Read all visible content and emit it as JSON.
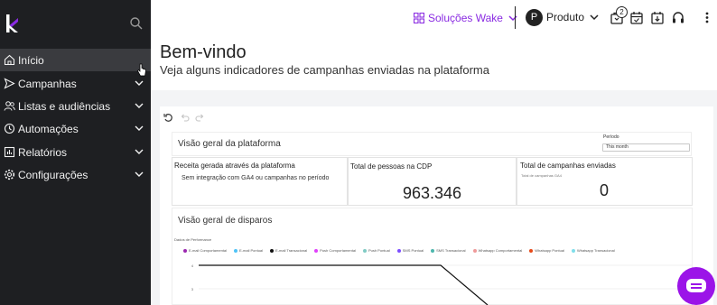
{
  "sidebar": {
    "items": [
      {
        "label": "Início",
        "icon": "home-icon",
        "active": true
      },
      {
        "label": "Campanhas",
        "icon": "send-icon"
      },
      {
        "label": "Listas e audiências",
        "icon": "users-icon"
      },
      {
        "label": "Automações",
        "icon": "automation-icon"
      },
      {
        "label": "Relatórios",
        "icon": "reports-icon"
      },
      {
        "label": "Configurações",
        "icon": "gear-icon"
      }
    ]
  },
  "topbar": {
    "workspace": "Soluções Wake",
    "user_initial": "P",
    "user_label": "Produto",
    "badge_count": "2",
    "accent_color": "#8a2be2"
  },
  "header": {
    "title": "Bem-vindo",
    "subtitle": "Veja alguns indicadores de campanhas enviadas na plataforma"
  },
  "dashboard": {
    "overview_title": "Visão geral da plataforma",
    "period_label": "Período",
    "period_value": "This month",
    "cards": {
      "revenue": {
        "title": "Receita gerada através da plataforma",
        "text": "Sem integração com GA4 ou campanhas no período"
      },
      "people": {
        "title": "Total de pessoas na CDP",
        "value": "963.346"
      },
      "campaigns": {
        "title": "Total de campanhas enviadas",
        "subtitle": "Total de campanhas GA4",
        "value": "0"
      }
    },
    "dispatch_title": "Visão geral de disparos",
    "performance_label": "Dados de Performance"
  },
  "chart_data": {
    "type": "line",
    "series": [
      {
        "name": "E-mail Comportamental",
        "color": "#9b27b0"
      },
      {
        "name": "E-mail Pontual",
        "color": "#4fc3f7"
      },
      {
        "name": "E-mail Transacional",
        "color": "#111111"
      },
      {
        "name": "Push Comportamental",
        "color": "#e040fb"
      },
      {
        "name": "Push Pontual",
        "color": "#80cbc4"
      },
      {
        "name": "SMS Pontual",
        "color": "#7c4dff"
      },
      {
        "name": "SMS Transacional",
        "color": "#4db6ac"
      },
      {
        "name": "Whatsapp Comportamental",
        "color": "#ef9a9a"
      },
      {
        "name": "Whatsapp Pontual",
        "color": "#e64a19"
      },
      {
        "name": "Whatsapp Transacional",
        "color": "#80deea"
      }
    ],
    "yticks": [
      "4",
      "3"
    ]
  }
}
